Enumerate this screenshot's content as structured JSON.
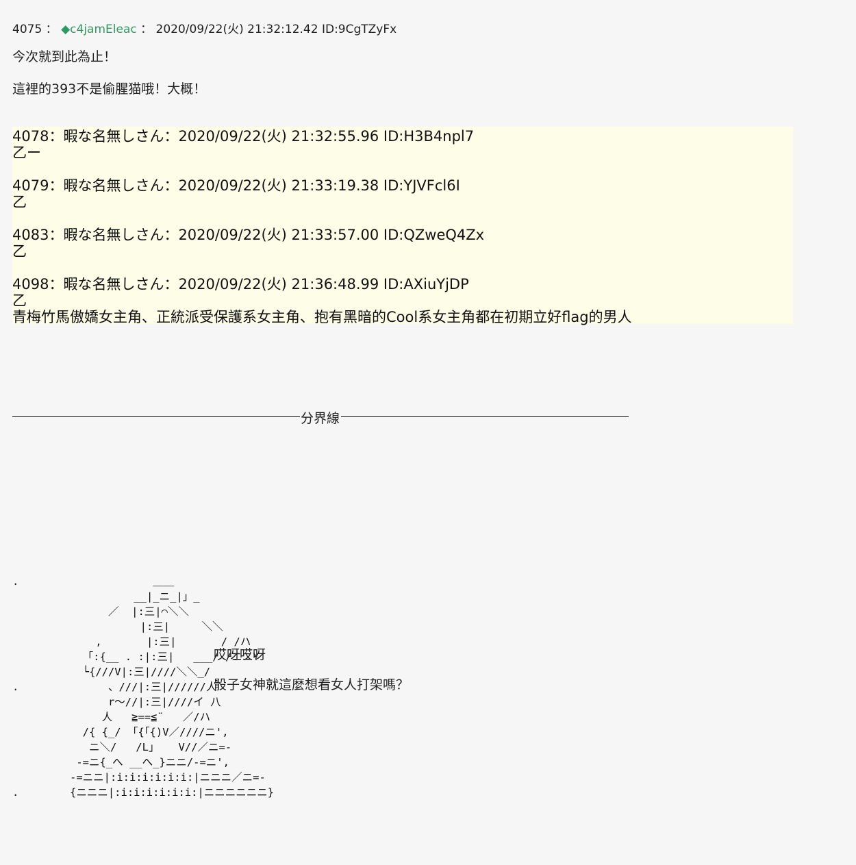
{
  "post": {
    "header": {
      "number": "4075",
      "sep1": "：",
      "trip": "◆c4jamEleac",
      "sep2": "：",
      "datetime": "2020/09/22(火) 21:32:12.42",
      "id": "ID:9CgTZyFx"
    },
    "lines": [
      "今次就到此為止！",
      "這裡的393不是偷腥猫哦！大概！"
    ]
  },
  "quotes": [
    {
      "header": "4078：暇な名無しさん：2020/09/22(火) 21:32:55.96 ID:H3B4npl7",
      "body": [
        "乙ー"
      ]
    },
    {
      "header": "4079：暇な名無しさん：2020/09/22(火) 21:33:19.38 ID:YJVFcl6I",
      "body": [
        "乙"
      ]
    },
    {
      "header": "4083：暇な名無しさん：2020/09/22(火) 21:33:57.00 ID:QZweQ4Zx",
      "body": [
        "乙"
      ]
    },
    {
      "header": "4098：暇な名無しさん：2020/09/22(火) 21:36:48.99 ID:AXiuYjDP",
      "body": [
        "乙",
        "青梅竹馬傲嬌女主角、正統派受保護系女主角、抱有黑暗的Cool系女主角都在初期立好flag的男人"
      ]
    }
  ],
  "divider": {
    "label": "分界線"
  },
  "ascii_art": ".                     ＿＿\n                   __|_ニ_|」_\n               ／  |:三|⌒＼＼\n                    |:三|     ＼＼\n             ,       |:三|       / /ハ\n           「:{__ . :|:三|   ___/ /ニニY\n           └{///V|:三|////＼＼_/\n.              、///|:三|//////人\n               r〜//|:三|////イ 八\n              人   ≧==≦¨   ／/ハ\n           /{ {_/ 「{「{)V／////ニ',\n            ニ＼/   /L」   V//／ニ=-\n          -=ニ{_へ __へ_}ニニ/-=ニ',\n         -=ニニ|:i:i:i:i:i:i:|ニニニ／ニ=-\n.        {ニニニ|:i:i:i:i:i:i:|ニニニニニニ}",
  "speech": [
    "哎呀哎呀",
    "骰子女神就這麼想看女人打架嗎？"
  ]
}
